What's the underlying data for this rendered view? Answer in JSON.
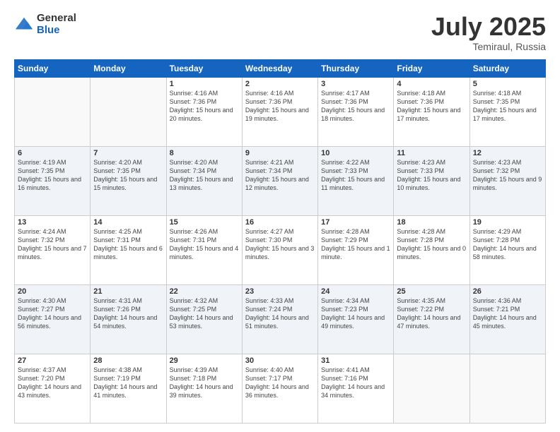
{
  "logo": {
    "general": "General",
    "blue": "Blue"
  },
  "header": {
    "month": "July 2025",
    "location": "Temiraul, Russia"
  },
  "days_of_week": [
    "Sunday",
    "Monday",
    "Tuesday",
    "Wednesday",
    "Thursday",
    "Friday",
    "Saturday"
  ],
  "weeks": [
    [
      {
        "day": "",
        "info": ""
      },
      {
        "day": "",
        "info": ""
      },
      {
        "day": "1",
        "info": "Sunrise: 4:16 AM\nSunset: 7:36 PM\nDaylight: 15 hours\nand 20 minutes."
      },
      {
        "day": "2",
        "info": "Sunrise: 4:16 AM\nSunset: 7:36 PM\nDaylight: 15 hours\nand 19 minutes."
      },
      {
        "day": "3",
        "info": "Sunrise: 4:17 AM\nSunset: 7:36 PM\nDaylight: 15 hours\nand 18 minutes."
      },
      {
        "day": "4",
        "info": "Sunrise: 4:18 AM\nSunset: 7:36 PM\nDaylight: 15 hours\nand 17 minutes."
      },
      {
        "day": "5",
        "info": "Sunrise: 4:18 AM\nSunset: 7:35 PM\nDaylight: 15 hours\nand 17 minutes."
      }
    ],
    [
      {
        "day": "6",
        "info": "Sunrise: 4:19 AM\nSunset: 7:35 PM\nDaylight: 15 hours\nand 16 minutes."
      },
      {
        "day": "7",
        "info": "Sunrise: 4:20 AM\nSunset: 7:35 PM\nDaylight: 15 hours\nand 15 minutes."
      },
      {
        "day": "8",
        "info": "Sunrise: 4:20 AM\nSunset: 7:34 PM\nDaylight: 15 hours\nand 13 minutes."
      },
      {
        "day": "9",
        "info": "Sunrise: 4:21 AM\nSunset: 7:34 PM\nDaylight: 15 hours\nand 12 minutes."
      },
      {
        "day": "10",
        "info": "Sunrise: 4:22 AM\nSunset: 7:33 PM\nDaylight: 15 hours\nand 11 minutes."
      },
      {
        "day": "11",
        "info": "Sunrise: 4:23 AM\nSunset: 7:33 PM\nDaylight: 15 hours\nand 10 minutes."
      },
      {
        "day": "12",
        "info": "Sunrise: 4:23 AM\nSunset: 7:32 PM\nDaylight: 15 hours\nand 9 minutes."
      }
    ],
    [
      {
        "day": "13",
        "info": "Sunrise: 4:24 AM\nSunset: 7:32 PM\nDaylight: 15 hours\nand 7 minutes."
      },
      {
        "day": "14",
        "info": "Sunrise: 4:25 AM\nSunset: 7:31 PM\nDaylight: 15 hours\nand 6 minutes."
      },
      {
        "day": "15",
        "info": "Sunrise: 4:26 AM\nSunset: 7:31 PM\nDaylight: 15 hours\nand 4 minutes."
      },
      {
        "day": "16",
        "info": "Sunrise: 4:27 AM\nSunset: 7:30 PM\nDaylight: 15 hours\nand 3 minutes."
      },
      {
        "day": "17",
        "info": "Sunrise: 4:28 AM\nSunset: 7:29 PM\nDaylight: 15 hours\nand 1 minute."
      },
      {
        "day": "18",
        "info": "Sunrise: 4:28 AM\nSunset: 7:28 PM\nDaylight: 15 hours\nand 0 minutes."
      },
      {
        "day": "19",
        "info": "Sunrise: 4:29 AM\nSunset: 7:28 PM\nDaylight: 14 hours\nand 58 minutes."
      }
    ],
    [
      {
        "day": "20",
        "info": "Sunrise: 4:30 AM\nSunset: 7:27 PM\nDaylight: 14 hours\nand 56 minutes."
      },
      {
        "day": "21",
        "info": "Sunrise: 4:31 AM\nSunset: 7:26 PM\nDaylight: 14 hours\nand 54 minutes."
      },
      {
        "day": "22",
        "info": "Sunrise: 4:32 AM\nSunset: 7:25 PM\nDaylight: 14 hours\nand 53 minutes."
      },
      {
        "day": "23",
        "info": "Sunrise: 4:33 AM\nSunset: 7:24 PM\nDaylight: 14 hours\nand 51 minutes."
      },
      {
        "day": "24",
        "info": "Sunrise: 4:34 AM\nSunset: 7:23 PM\nDaylight: 14 hours\nand 49 minutes."
      },
      {
        "day": "25",
        "info": "Sunrise: 4:35 AM\nSunset: 7:22 PM\nDaylight: 14 hours\nand 47 minutes."
      },
      {
        "day": "26",
        "info": "Sunrise: 4:36 AM\nSunset: 7:21 PM\nDaylight: 14 hours\nand 45 minutes."
      }
    ],
    [
      {
        "day": "27",
        "info": "Sunrise: 4:37 AM\nSunset: 7:20 PM\nDaylight: 14 hours\nand 43 minutes."
      },
      {
        "day": "28",
        "info": "Sunrise: 4:38 AM\nSunset: 7:19 PM\nDaylight: 14 hours\nand 41 minutes."
      },
      {
        "day": "29",
        "info": "Sunrise: 4:39 AM\nSunset: 7:18 PM\nDaylight: 14 hours\nand 39 minutes."
      },
      {
        "day": "30",
        "info": "Sunrise: 4:40 AM\nSunset: 7:17 PM\nDaylight: 14 hours\nand 36 minutes."
      },
      {
        "day": "31",
        "info": "Sunrise: 4:41 AM\nSunset: 7:16 PM\nDaylight: 14 hours\nand 34 minutes."
      },
      {
        "day": "",
        "info": ""
      },
      {
        "day": "",
        "info": ""
      }
    ]
  ]
}
